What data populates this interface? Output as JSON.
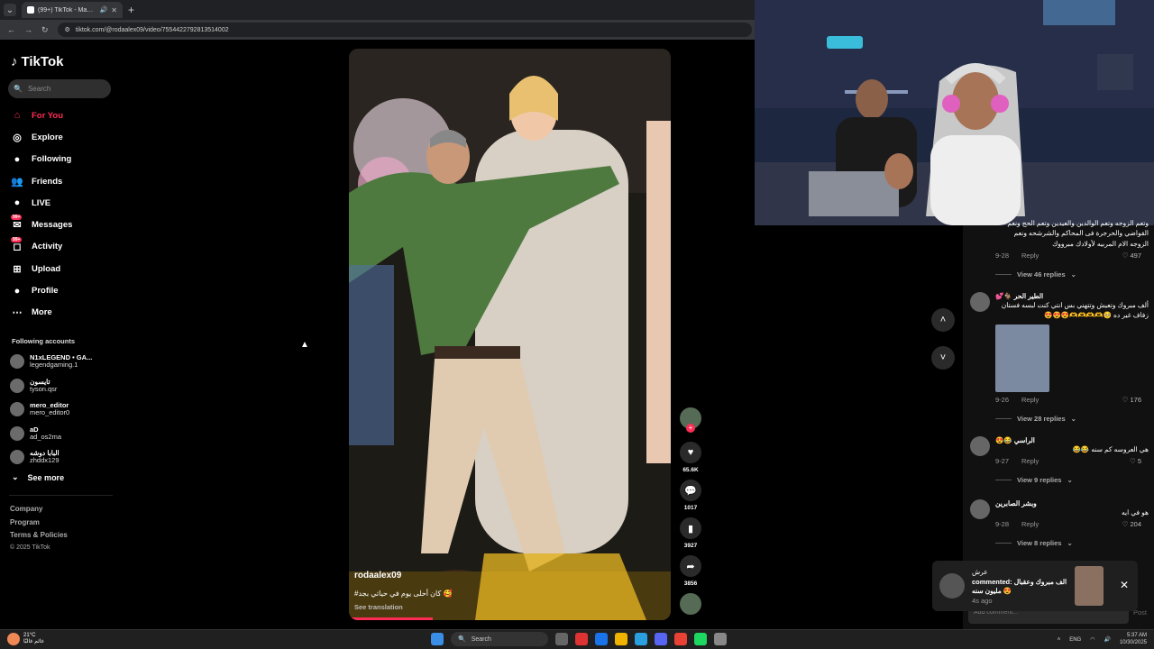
{
  "browser": {
    "tab_title": "(99+) TikTok - Make Your Day",
    "url": "tiktok.com/@rodaalex09/video/7554422792813514002"
  },
  "brand": {
    "name": "TikTok"
  },
  "search": {
    "placeholder": "Search"
  },
  "nav": [
    {
      "label": "For You",
      "icon": "home-icon"
    },
    {
      "label": "Explore",
      "icon": "compass-icon"
    },
    {
      "label": "Following",
      "icon": "following-icon"
    },
    {
      "label": "Friends",
      "icon": "friends-icon"
    },
    {
      "label": "LIVE",
      "icon": "live-icon"
    },
    {
      "label": "Messages",
      "icon": "messages-icon",
      "badge": "99+"
    },
    {
      "label": "Activity",
      "icon": "activity-icon",
      "badge": "99+"
    },
    {
      "label": "Upload",
      "icon": "upload-icon"
    },
    {
      "label": "Profile",
      "icon": "profile-icon"
    },
    {
      "label": "More",
      "icon": "more-icon"
    }
  ],
  "following_title": "Following accounts",
  "following": [
    {
      "name": "N1xLEGEND • GA...",
      "handle": "legendgaming.1"
    },
    {
      "name": "تايسون",
      "handle": "tyson.qsr"
    },
    {
      "name": "mero_editor",
      "handle": "mero_editor0"
    },
    {
      "name": "aD",
      "handle": "ad_os2ma"
    },
    {
      "name": "البابا دوشه",
      "handle": "zhddx129"
    }
  ],
  "see_more": "See more",
  "footer": {
    "company": "Company",
    "program": "Program",
    "terms": "Terms & Policies",
    "copyright": "© 2025 TikTok"
  },
  "video": {
    "author": "rodaalex09",
    "caption": "#كان أحلى يوم في حياتي بجد 🥰",
    "see_translation": "See translation",
    "likes": "65.6K",
    "comments": "1017",
    "saves": "3927",
    "shares": "3856",
    "progress": 0.26
  },
  "comments": [
    {
      "text": "وتعم الزوجه وتعم الوالدين والعيدين وتعم الحج ونعم القواضي والحرجرة فى المحاكم والشرشحه ونعم الزوجه الام المربيه لأولادك مبرووك",
      "date": "9-28",
      "reply": "Reply",
      "likes": "497",
      "view_replies": "View 46 replies"
    },
    {
      "name": "الطير الحر 🐐💕",
      "text": "ألف مبروك وتعيش وتتهني بس انتي كنت لبسه فستان زفاف غير ده 🥺🫶🫶🫶🫶😍😍😍",
      "date": "9-26",
      "reply": "Reply",
      "likes": "176",
      "view_replies": "View 28 replies"
    },
    {
      "name": "الراسي 😂😍",
      "text": "هي العروسه كم سنه 😂😂",
      "date": "9-27",
      "reply": "Reply",
      "likes": "5",
      "view_replies": "View 9 replies"
    },
    {
      "name": "وبشر الصابرين",
      "text": "هو في ايه",
      "date": "9-28",
      "reply": "Reply",
      "likes": "204",
      "view_replies": "View 8 replies"
    }
  ],
  "toast": {
    "user": "عرش",
    "line": "commented: الف مبروك وعقبال مليون سنه 😍",
    "time": "4s ago"
  },
  "comment_input": {
    "placeholder": "Add comment...",
    "post": "Post"
  },
  "taskbar": {
    "temp": "21°C",
    "weather_note": "غائم غالبًا",
    "search": "Search",
    "lang": "ENG",
    "time": "5:37 AM",
    "date": "10/30/2025"
  }
}
